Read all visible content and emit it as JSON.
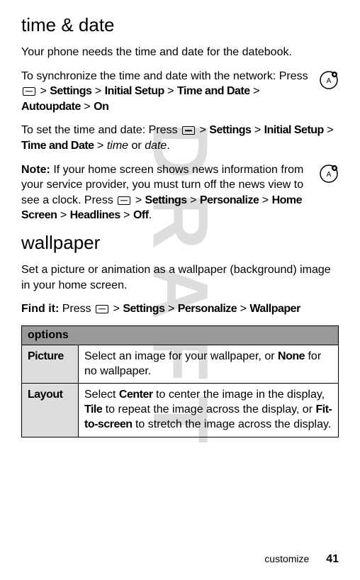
{
  "watermark": "DRAFT",
  "section1": {
    "heading": "time & date",
    "intro": "Your phone needs the time and date for the datebook.",
    "sync_pre": "To synchronize the time and date with the network: Press ",
    "gt": ">",
    "path": {
      "settings": "Settings",
      "initial_setup": "Initial Setup",
      "time_and_date": "Time and Date",
      "autoupdate": "Autoupdate",
      "on": "On"
    },
    "set_pre": "To set the time and date: Press ",
    "set_time": "time",
    "set_or": " or ",
    "set_date": "date",
    "set_period": ".",
    "note_label": "Note:",
    "note_body1": " If your home screen shows news information from your service provider, you must turn off the news view to see a clock. Press ",
    "path2": {
      "personalize": "Personalize",
      "home_screen": "Home Screen",
      "headlines": "Headlines",
      "off": "Off"
    }
  },
  "section2": {
    "heading": "wallpaper",
    "intro": "Set a picture or animation as a wallpaper (background) image in your home screen.",
    "findit_label": "Find it:",
    "findit_pre": " Press ",
    "path": {
      "settings": "Settings",
      "personalize": "Personalize",
      "wallpaper": "Wallpaper"
    },
    "table": {
      "header": "options",
      "rows": [
        {
          "name": "Picture",
          "desc_pre": "Select an image for your wallpaper, or ",
          "desc_bold": "None",
          "desc_post": " for no wallpaper."
        },
        {
          "name": "Layout",
          "p1_pre": "Select ",
          "p1_b1": "Center",
          "p1_mid1": " to center the image in the display, ",
          "p1_b2": "Tile",
          "p1_mid2": " to repeat the image across the display, or ",
          "p1_b3": "Fit-to-screen",
          "p1_post": " to stretch the image across the display."
        }
      ]
    }
  },
  "footer": {
    "label": "customize",
    "page": "41"
  }
}
